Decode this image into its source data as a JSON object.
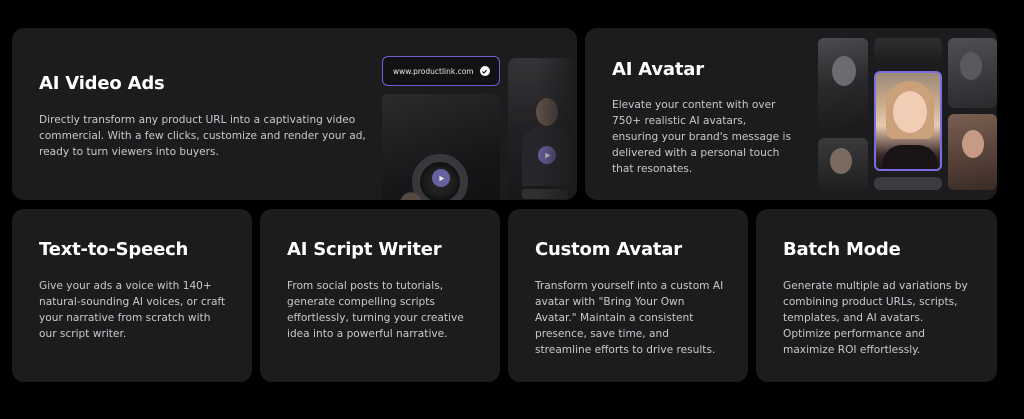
{
  "cards": {
    "video_ads": {
      "title": "AI Video Ads",
      "description": "Directly transform any product URL into a captivating video commercial. With a few clicks, customize and render your ad, ready to turn viewers into buyers.",
      "url_pill": "www.productlink.com"
    },
    "avatar": {
      "title": "AI Avatar",
      "description": "Elevate your content with over 750+ realistic AI avatars, ensuring your brand's message is delivered with a personal touch that resonates."
    },
    "tts": {
      "title": "Text-to-Speech",
      "description": "Give your ads a voice with 140+ natural-sounding AI voices, or craft your narrative from scratch with our script writer."
    },
    "script": {
      "title": "AI Script Writer",
      "description": "From social posts to tutorials, generate compelling scripts effortlessly, turning your creative idea into a powerful narrative."
    },
    "custom_avatar": {
      "title": "Custom Avatar",
      "description": "Transform yourself into a custom AI avatar with \"Bring Your Own Avatar.\" Maintain a consistent presence, save time, and streamline efforts to drive results."
    },
    "batch": {
      "title": "Batch Mode",
      "description": "Generate multiple ad variations by combining product URLs, scripts, templates, and AI avatars. Optimize performance and maximize ROI effortlessly."
    }
  },
  "colors": {
    "background": "#000000",
    "card": "#1c1c1e",
    "accent": "#6b5fd3",
    "text_secondary": "#c9c9cc"
  },
  "icons": {
    "check": "check-circle-icon",
    "play": "play-icon"
  }
}
